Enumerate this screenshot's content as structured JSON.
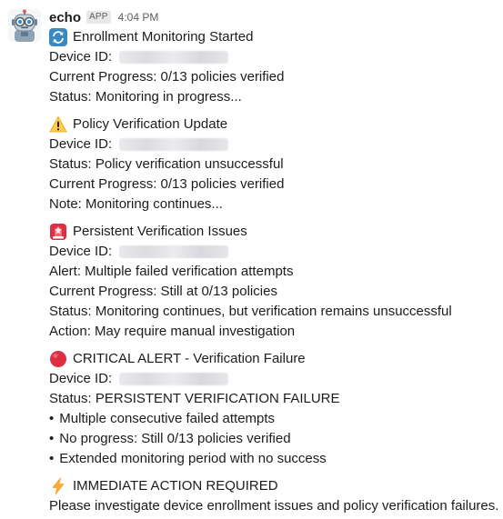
{
  "message": {
    "sender": "echo",
    "badge": "APP",
    "time": "4:04 PM",
    "sections": [
      {
        "icon": "arrows-counterclockwise-icon",
        "title": "Enrollment Monitoring Started",
        "device_label": "Device ID:",
        "lines": [
          "Current Progress: 0/13 policies verified",
          "Status: Monitoring in progress..."
        ]
      },
      {
        "icon": "warning-icon",
        "title": "Policy Verification Update",
        "device_label": "Device ID:",
        "lines": [
          "Status: Policy verification unsuccessful",
          "Current Progress: 0/13 policies verified",
          "Note: Monitoring continues..."
        ]
      },
      {
        "icon": "rotating-light-icon",
        "title": "Persistent Verification Issues",
        "device_label": "Device ID:",
        "lines": [
          "Alert: Multiple failed verification attempts",
          "Current Progress: Still at 0/13 policies",
          "Status: Monitoring continues, but verification remains unsuccessful",
          "Action: May require manual investigation"
        ]
      },
      {
        "icon": "red-circle-icon",
        "title": "CRITICAL ALERT - Verification Failure",
        "device_label": "Device ID:",
        "lines": [
          "Status: PERSISTENT VERIFICATION FAILURE"
        ],
        "bullet": "•",
        "bullets": [
          "Multiple consecutive failed attempts",
          "No progress: Still 0/13 policies verified",
          "Extended monitoring period with no success"
        ]
      },
      {
        "icon": "high-voltage-icon",
        "title": "IMMEDIATE ACTION REQUIRED",
        "lines": [
          "Please investigate device enrollment issues and policy verification failures."
        ]
      }
    ]
  },
  "colors": {
    "text": "#1d1c1d",
    "muted": "#616061",
    "badge_bg": "#e8e8e8",
    "sync_blue": "#3b88c3",
    "warning_yellow": "#ffcc4d",
    "alarm_red": "#dd2e44",
    "critical_red": "#dd2e44",
    "bolt_yellow": "#ffac33"
  }
}
